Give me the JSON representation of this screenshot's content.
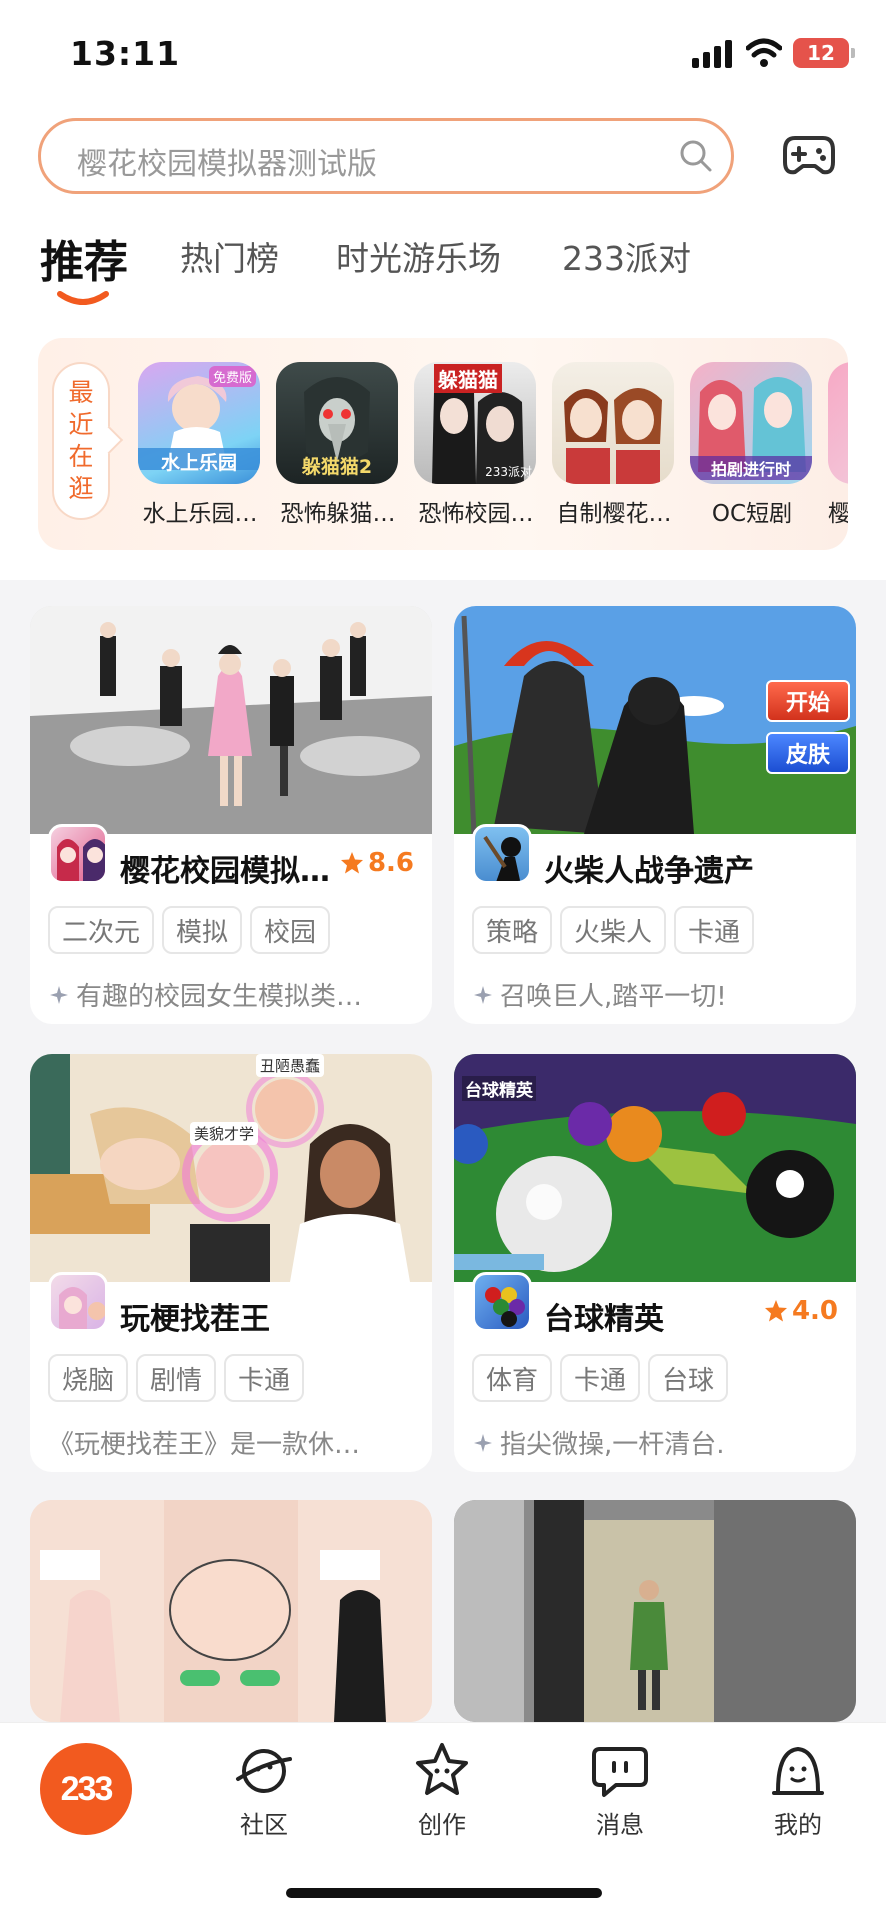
{
  "status_bar": {
    "time": "13:11",
    "battery": "12"
  },
  "search": {
    "placeholder": "樱花校园模拟器测试版"
  },
  "tabs": [
    {
      "label": "推荐",
      "active": true
    },
    {
      "label": "热门榜"
    },
    {
      "label": "时光游乐场"
    },
    {
      "label": "233派对"
    }
  ],
  "recent": {
    "label_chars": [
      "最",
      "近",
      "在",
      "逛"
    ],
    "items": [
      {
        "name": "水上乐园…",
        "icon_caption": "水上乐园",
        "badge": "免费版"
      },
      {
        "name": "恐怖躲猫…",
        "icon_caption": "躲猫猫2"
      },
      {
        "name": "恐怖校园…",
        "icon_caption": "躲猫猫",
        "badge": "233派对"
      },
      {
        "name": "自制樱花…"
      },
      {
        "name": "OC短剧",
        "icon_caption": "拍剧进行时"
      },
      {
        "name": "樱"
      }
    ]
  },
  "cards": [
    {
      "title": "樱花校园模拟…",
      "rating": "8.6",
      "tags": [
        "二次元",
        "模拟",
        "校园"
      ],
      "desc": "有趣的校园女生模拟类…",
      "has_spark": true
    },
    {
      "title": "火柴人战争遗产",
      "rating": "",
      "tags": [
        "策略",
        "火柴人",
        "卡通"
      ],
      "desc": "召唤巨人,踏平一切!",
      "has_spark": true,
      "img_buttons": [
        "开始",
        "皮肤"
      ]
    },
    {
      "title": "玩梗找茬王",
      "rating": "",
      "tags": [
        "烧脑",
        "剧情",
        "卡通"
      ],
      "desc": "《玩梗找茬王》是一款休…",
      "has_spark": false,
      "img_labels": [
        "丑陋愚蠢",
        "美貌才学"
      ]
    },
    {
      "title": "台球精英",
      "rating": "4.0",
      "tags": [
        "体育",
        "卡通",
        "台球"
      ],
      "desc": "指尖微操,一杆清台.",
      "has_spark": true,
      "img_labels": [
        "台球精英"
      ]
    }
  ],
  "bottom_nav": {
    "logo": "233",
    "items": [
      {
        "label": "社区",
        "icon": "planet-face-icon"
      },
      {
        "label": "创作",
        "icon": "star-face-icon"
      },
      {
        "label": "消息",
        "icon": "chat-bubble-icon"
      },
      {
        "label": "我的",
        "icon": "person-face-icon"
      }
    ]
  },
  "colors": {
    "accent": "#f25a1f",
    "rating": "#f57a20",
    "search_border": "#f0a27a"
  }
}
